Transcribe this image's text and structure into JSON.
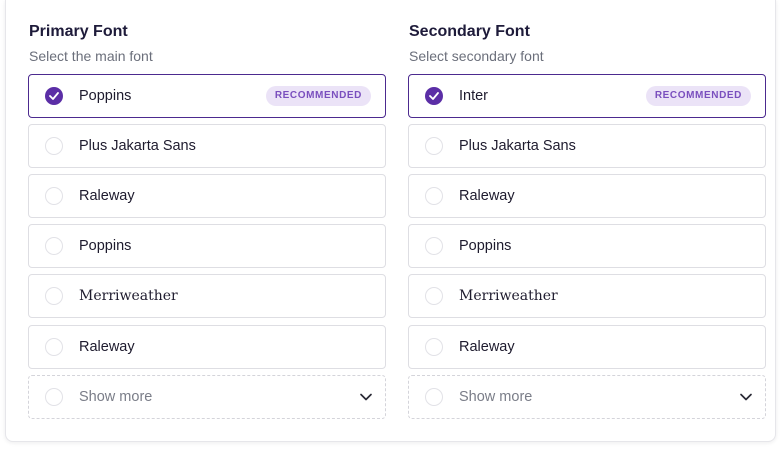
{
  "primary": {
    "title": "Primary Font",
    "subtitle": "Select the main font",
    "options": [
      {
        "label": "Poppins",
        "selected": true,
        "badge": "RECOMMENDED"
      },
      {
        "label": "Plus Jakarta Sans",
        "selected": false
      },
      {
        "label": "Raleway",
        "selected": false
      },
      {
        "label": "Poppins",
        "selected": false
      },
      {
        "label": "Merriweather",
        "selected": false
      },
      {
        "label": "Raleway",
        "selected": false
      }
    ],
    "show_more": "Show more"
  },
  "secondary": {
    "title": "Secondary Font",
    "subtitle": "Select secondary font",
    "options": [
      {
        "label": "Inter",
        "selected": true,
        "badge": "RECOMMENDED"
      },
      {
        "label": "Plus Jakarta Sans",
        "selected": false
      },
      {
        "label": "Raleway",
        "selected": false
      },
      {
        "label": "Poppins",
        "selected": false
      },
      {
        "label": "Merriweather",
        "selected": false
      },
      {
        "label": "Raleway",
        "selected": false
      }
    ],
    "show_more": "Show more"
  },
  "icons": {
    "check": "check-icon",
    "chevron": "chevron-down-icon"
  },
  "colors": {
    "accent": "#5b2ea6",
    "selected_border": "#4c2a8f",
    "badge_bg": "#ebe3f7",
    "badge_text": "#7a4fbe"
  }
}
